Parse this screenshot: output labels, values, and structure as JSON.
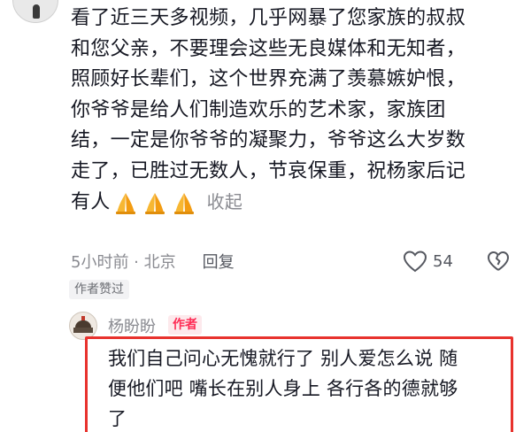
{
  "comment": {
    "lines": [
      "看了近三天多视频，几乎网暴了您家族的叔叔",
      "和您父亲，不要理会这些无良媒体和无知者，",
      "照顾好长辈们，这个世界充满了羡慕嫉妒恨，",
      "你爷爷是给人们制造欢乐的艺术家，家族团",
      "结，一定是你爷爷的凝聚力，爷爷这么大岁数",
      "走了，已胜过无数人，节哀保重，祝杨家后记"
    ],
    "last_line_text": "有人",
    "emojis": [
      "pray-icon",
      "pray-icon",
      "pray-icon"
    ],
    "collapse_label": "收起",
    "time_location": "5小时前 · 北京",
    "reply_label": "回复",
    "like_count": "54",
    "author_liked_label": "作者赞过"
  },
  "reply": {
    "name": "杨盼盼",
    "badge": "作者",
    "lines": [
      "我们自己问心无愧就行了 别人爱怎么说 随",
      "便他们吧 嘴长在别人身上 各行各的德就够",
      "了"
    ]
  },
  "colors": {
    "accent_red": "#fe2c55",
    "highlight_border": "#e8322d",
    "secondary_text": "#8a8b91"
  }
}
